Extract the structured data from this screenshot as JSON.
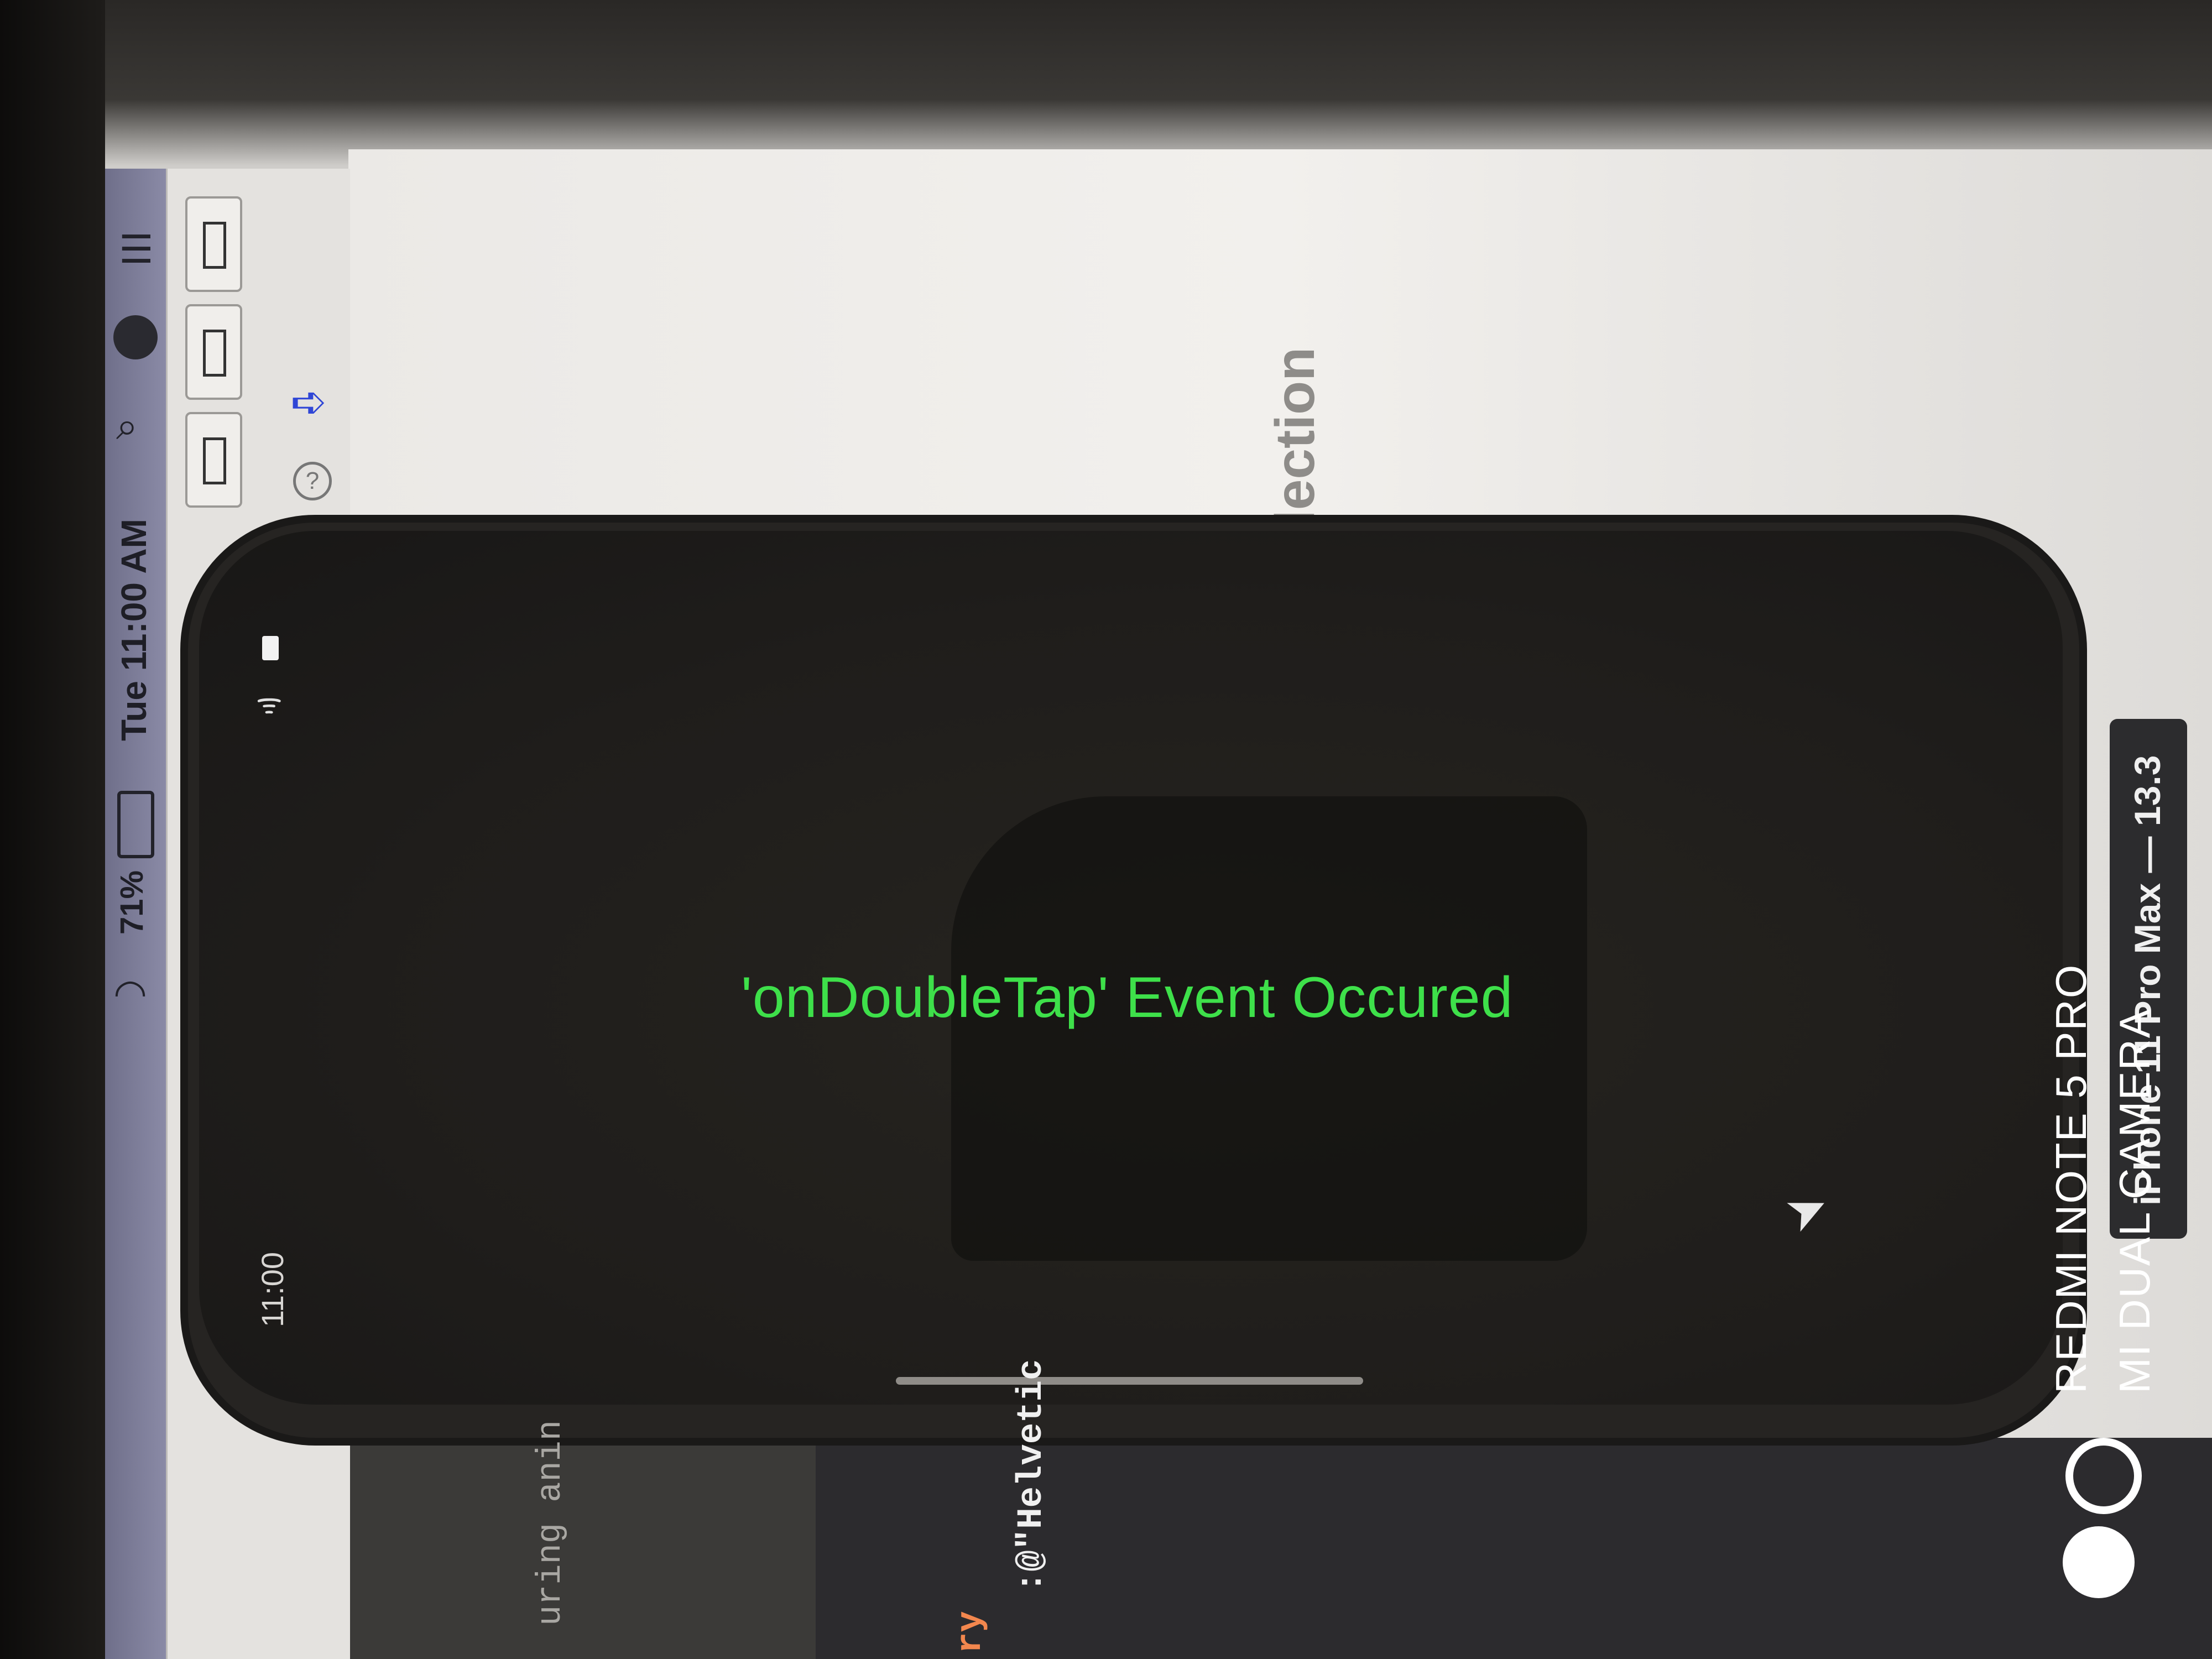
{
  "menubar": {
    "clock": "Tue 11:00 AM",
    "battery_percent": "71%",
    "icons": [
      "wifi-icon",
      "battery-icon",
      "search-icon",
      "siri-icon",
      "list-icon"
    ]
  },
  "editor": {
    "faint_text": "lection"
  },
  "simulator": {
    "event_text": "'onDoubleTap' Event Occured",
    "status_time": "11:00",
    "device_label": "iPhone 11 Pro Max — 13.3"
  },
  "code": {
    "line1": "uring anin",
    "line2": "ry",
    "line3": ":@\"Helvetic"
  },
  "watermark": {
    "line1": "REDMI NOTE 5 PRO",
    "line2": "MI DUAL CAMERA"
  },
  "colors": {
    "event_text": "#3ee04a",
    "menubar": "#7c7c98",
    "phone_screen": "#201e1c"
  }
}
